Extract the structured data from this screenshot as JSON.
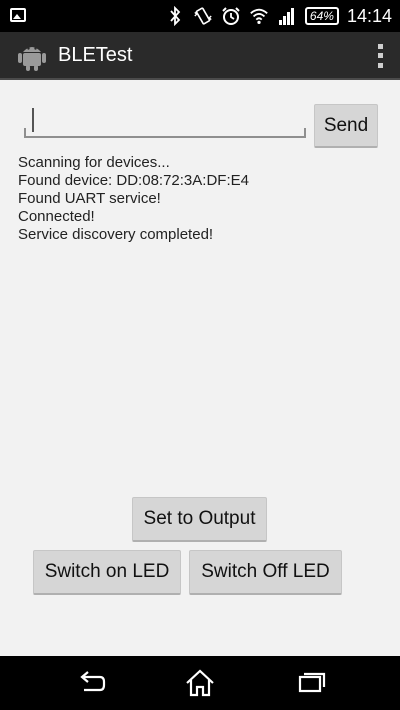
{
  "status_bar": {
    "battery_level": "64%",
    "time": "14:14",
    "icons": [
      "picture-icon",
      "bluetooth-icon",
      "vibrate-icon",
      "alarm-icon",
      "wifi-icon",
      "signal-icon",
      "battery-icon"
    ]
  },
  "action_bar": {
    "title": "BLETest",
    "icon": "android-icon",
    "menu_icon": "overflow-menu-icon"
  },
  "input": {
    "value": "",
    "send_label": "Send"
  },
  "log": {
    "lines": [
      "Scanning for devices...",
      "Found device: DD:08:72:3A:DF:E4",
      "Found UART service!",
      "Connected!",
      "Service discovery completed!"
    ]
  },
  "buttons": {
    "set_output": "Set to Output",
    "switch_on": "Switch on LED",
    "switch_off": "Switch Off LED"
  },
  "nav_bar": {
    "icons": [
      "back-icon",
      "home-icon",
      "recents-icon"
    ]
  }
}
